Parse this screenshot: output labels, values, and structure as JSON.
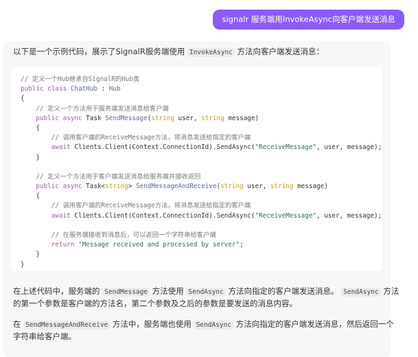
{
  "user_message": "signalr 服务端用InvokeAsync向客户端发送消息",
  "colors": {
    "bubble": "#8b5cf6",
    "panel": "#f7f7f8"
  },
  "intro": [
    "以下是一个示例代码，展示了SignalR服务端使用 ",
    "InvokeAsync",
    " 方法向客户端发送消息："
  ],
  "code_lines": [
    [
      [
        "cm",
        "// 定义一个Hub继承自SignalR的Hub类"
      ]
    ],
    [
      [
        "kw",
        "public class "
      ],
      [
        "fn",
        "ChatHub"
      ],
      [
        "pl",
        " : "
      ],
      [
        "fn",
        "Hub"
      ]
    ],
    [
      [
        "pl",
        "{"
      ]
    ],
    [
      [
        "cm",
        "    // 定义一个方法用于服务端发送消息给客户端"
      ]
    ],
    [
      [
        "kw",
        "    public async "
      ],
      [
        "pl",
        "Task "
      ],
      [
        "fn",
        "SendMessage"
      ],
      [
        "pl",
        "("
      ],
      [
        "ty",
        "string"
      ],
      [
        "pl",
        " user, "
      ],
      [
        "ty",
        "string"
      ],
      [
        "pl",
        " message)"
      ]
    ],
    [
      [
        "pl",
        "    {"
      ]
    ],
    [
      [
        "cm",
        "        // 调用客户端的ReceiveMessage方法，将消息发送给指定的客户端"
      ]
    ],
    [
      [
        "kw",
        "        await "
      ],
      [
        "pl",
        "Clients.Client(Context.ConnectionId).SendAsync("
      ],
      [
        "st",
        "\"ReceiveMessage\""
      ],
      [
        "pl",
        ", user, message);"
      ]
    ],
    [
      [
        "pl",
        "    }"
      ]
    ],
    [
      [
        "pl",
        ""
      ]
    ],
    [
      [
        "cm",
        "    // 定义一个方法用于客户端发送消息给服务端并接收返回"
      ]
    ],
    [
      [
        "kw",
        "    public async "
      ],
      [
        "pl",
        "Task<"
      ],
      [
        "ty",
        "string"
      ],
      [
        "pl",
        "> "
      ],
      [
        "fn",
        "SendMessageAndReceive"
      ],
      [
        "pl",
        "("
      ],
      [
        "ty",
        "string"
      ],
      [
        "pl",
        " user, "
      ],
      [
        "ty",
        "string"
      ],
      [
        "pl",
        " message)"
      ]
    ],
    [
      [
        "pl",
        "    {"
      ]
    ],
    [
      [
        "cm",
        "        // 调用客户端的ReceiveMessage方法，将消息发送给指定的客户端"
      ]
    ],
    [
      [
        "kw",
        "        await "
      ],
      [
        "pl",
        "Clients.Client(Context.ConnectionId).SendAsync("
      ],
      [
        "st",
        "\"ReceiveMessage\""
      ],
      [
        "pl",
        ", user, message);"
      ]
    ],
    [
      [
        "pl",
        ""
      ]
    ],
    [
      [
        "cm",
        "        // 在服务端接收到消息后，可以返回一个字符串给客户端"
      ]
    ],
    [
      [
        "kw",
        "        return "
      ],
      [
        "st",
        "\"Message received and processed by server\""
      ],
      [
        "pl",
        ";"
      ]
    ],
    [
      [
        "pl",
        "    }"
      ]
    ],
    [
      [
        "pl",
        "}"
      ]
    ]
  ],
  "para1": {
    "line1": [
      "在上述代码中，服务端的 ",
      "SendMessage",
      " 方法使用 ",
      "SendAsync",
      " 方法向指定的客户端发送消息。 ",
      "SendAsync",
      " 方法"
    ],
    "line2": "的第一个参数是客户端的方法名，第二个参数及之后的参数是要发送的消息内容。"
  },
  "para2": {
    "line1": [
      "在 ",
      "SendMessageAndReceive",
      " 方法中，服务端也使用 ",
      "SendAsync",
      " 方法向指定的客户端发送消息，然后返回一个"
    ],
    "line2": "字符串给客户端。"
  }
}
